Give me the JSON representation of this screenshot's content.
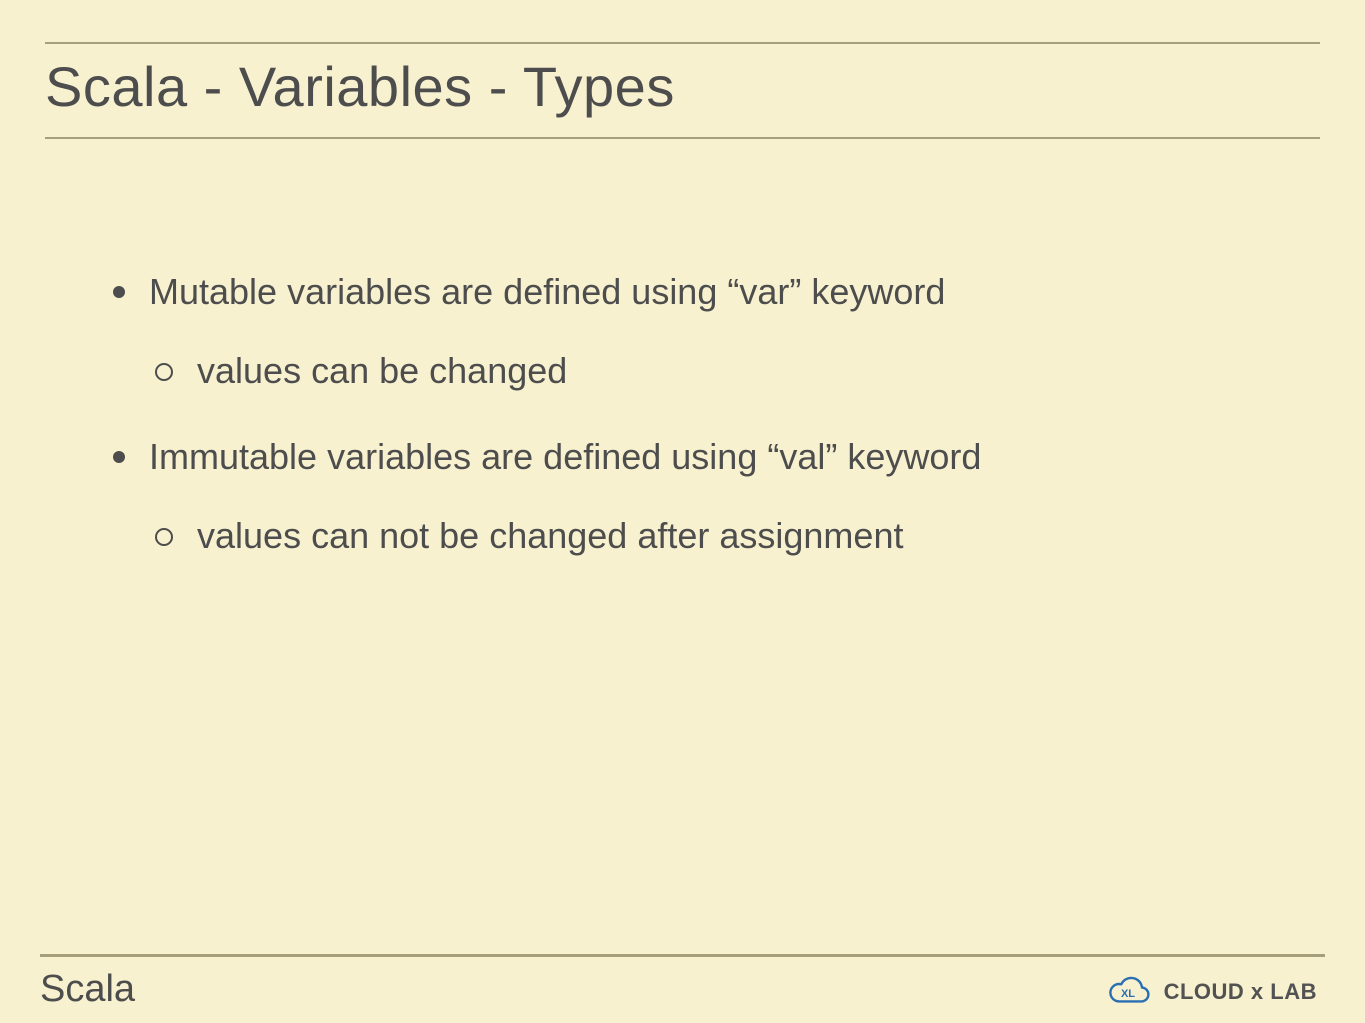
{
  "slide": {
    "title": "Scala - Variables - Types",
    "bullets": [
      {
        "text": "Mutable variables are defined using “var” keyword",
        "sub": [
          {
            "text": "values can be changed"
          }
        ]
      },
      {
        "text": "Immutable variables are defined using “val” keyword",
        "sub": [
          {
            "text": "values can not be changed after assignment"
          }
        ]
      }
    ],
    "footer_label": "Scala",
    "logo": {
      "brand_text": "CLOUD x LAB",
      "inner_text": "XL"
    }
  }
}
